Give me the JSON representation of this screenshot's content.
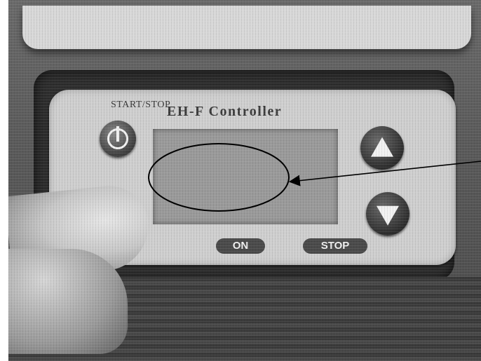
{
  "panel": {
    "start_stop_label": "START/STOP",
    "brand": "EH-F Controller",
    "on_label": "ON",
    "stop_label": "STOP"
  },
  "colors": {
    "faceplate": "#cfcfcf",
    "lcd": "#9a9a9a",
    "button": "#3a3a3a",
    "annotation": "#000000"
  },
  "icons": {
    "power": "power-icon",
    "up": "up-arrow-icon",
    "down": "down-arrow-icon"
  }
}
